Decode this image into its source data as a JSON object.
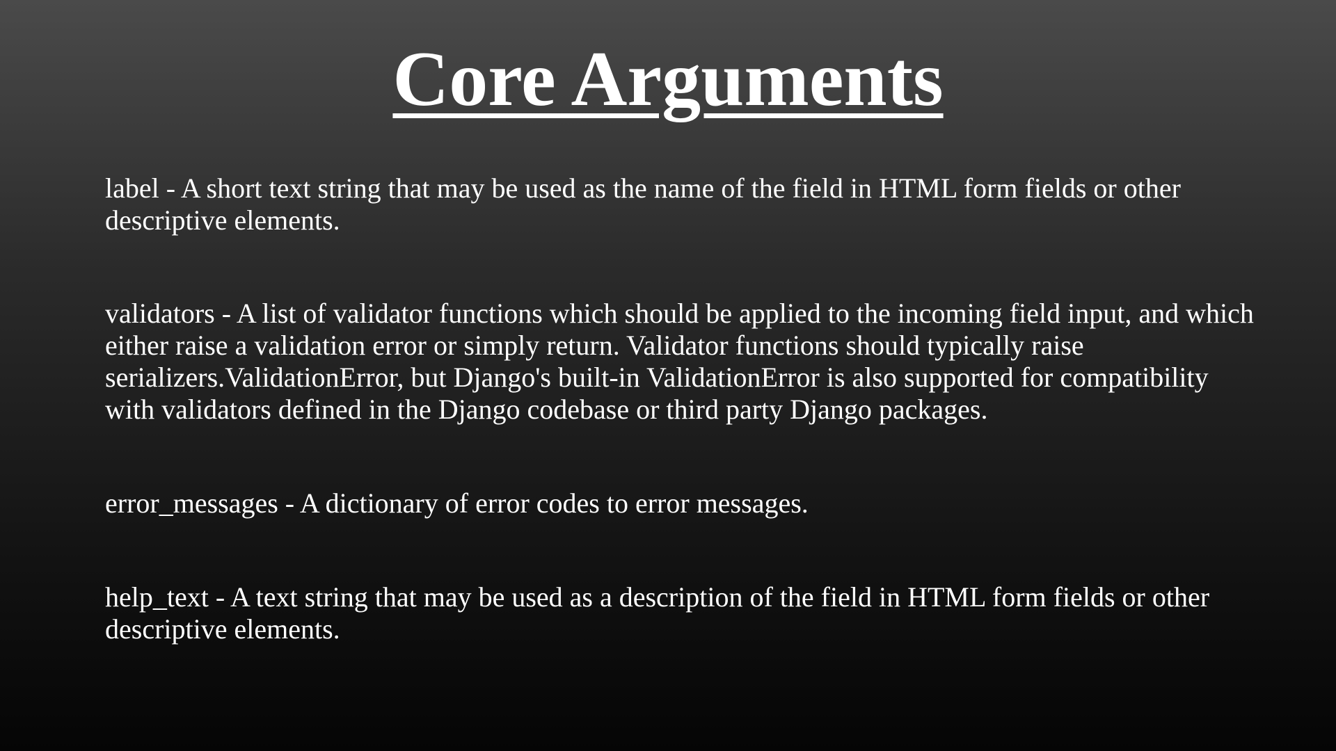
{
  "slide": {
    "title": "Core Arguments",
    "arguments": [
      {
        "text": "label - A short text string that may be used as the name of the field in HTML form fields or other descriptive elements."
      },
      {
        "text": "validators - A list of validator functions which should be applied to the incoming field input, and which either raise a validation error or simply return. Validator functions should typically raise serializers.ValidationError, but Django's built-in ValidationError is also supported for compatibility with validators defined in the Django codebase or third party Django packages."
      },
      {
        "text": "error_messages - A dictionary of error codes to error messages."
      },
      {
        "text": "help_text - A text string that may be used as a description of the field in HTML form fields or other descriptive elements."
      }
    ]
  }
}
